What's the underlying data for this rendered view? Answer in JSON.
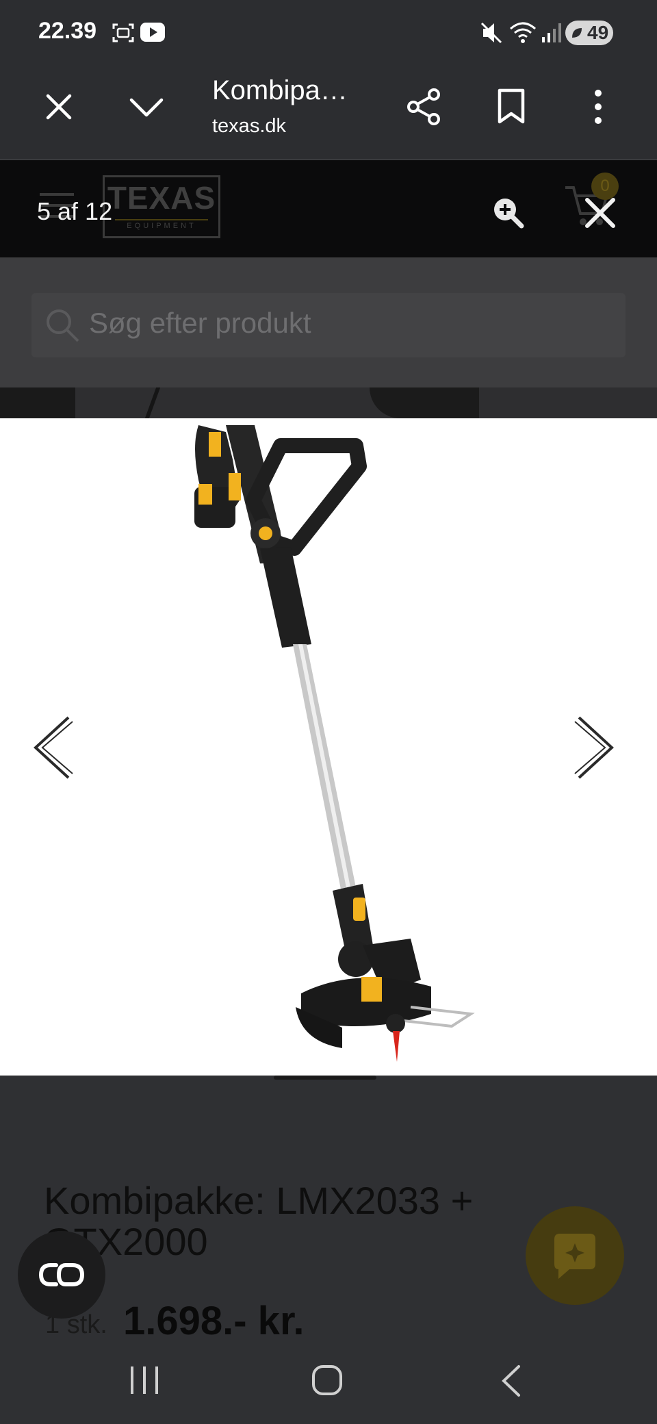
{
  "status_bar": {
    "time": "22.39",
    "battery": "49"
  },
  "custom_tab": {
    "title": "Kombipa…",
    "url": "texas.dk"
  },
  "site": {
    "logo_main": "TEXAS",
    "logo_sub": "EQUIPMENT",
    "cart_count": "0",
    "search_placeholder": "Søg efter produkt"
  },
  "viewer": {
    "counter": "5 af 12"
  },
  "product": {
    "title": "Kombipakke: LMX2033 + GTX2000",
    "quantity": "1 stk.",
    "price": "1.698.- kr."
  },
  "colors": {
    "brand_accent": "#f2b21f",
    "header_bg": "#0b0b0c",
    "overlay_dim": "#2f3033"
  },
  "icons": {
    "close": "close-icon",
    "chevron": "chevron-down-icon",
    "share": "share-icon",
    "bookmark": "bookmark-icon",
    "menu": "more-vert-icon",
    "zoom": "zoom-in-icon",
    "viewer_close": "close-icon",
    "prev": "chevron-left-icon",
    "next": "chevron-right-icon",
    "lens": "google-lens-icon",
    "chat": "chat-icon"
  }
}
